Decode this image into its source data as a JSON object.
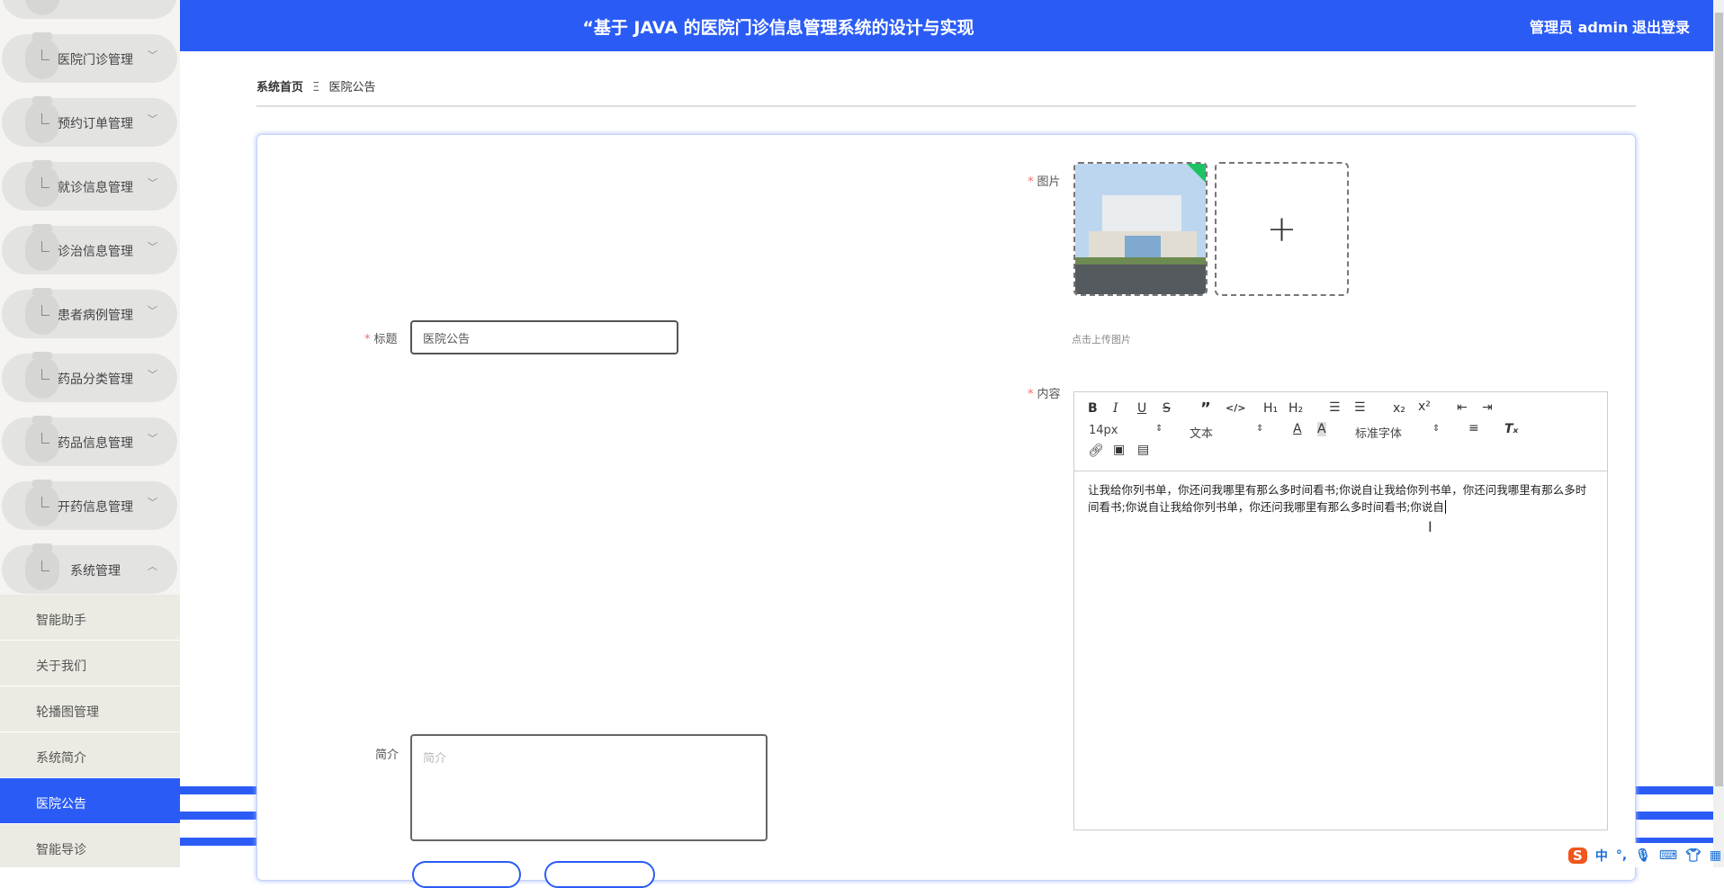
{
  "header": {
    "title": "“基于 JAVA 的医院门诊信息管理系统的设计与实现",
    "user": "管理员 admin",
    "logout": "退出登录"
  },
  "sidebar": {
    "menus": [
      {
        "label": "医院门诊管理"
      },
      {
        "label": "预约订单管理"
      },
      {
        "label": "就诊信息管理"
      },
      {
        "label": "诊治信息管理"
      },
      {
        "label": "患者病例管理"
      },
      {
        "label": "药品分类管理"
      },
      {
        "label": "药品信息管理"
      },
      {
        "label": "开药信息管理"
      },
      {
        "label": "系统管理"
      }
    ],
    "submenu": [
      {
        "label": "智能助手"
      },
      {
        "label": "关于我们"
      },
      {
        "label": "轮播图管理"
      },
      {
        "label": "系统简介"
      },
      {
        "label": "医院公告"
      },
      {
        "label": "智能导诊"
      }
    ]
  },
  "breadcrumb": {
    "home": "系统首页",
    "sep": "Ξ",
    "current": "医院公告"
  },
  "form": {
    "title_label": "标题",
    "title_value": "医院公告",
    "image_label": "图片",
    "upload_hint": "点击上传图片",
    "content_label": "内容",
    "content_value": "让我给你列书单，你还问我哪里有那么多时间看书;你说自让我给你列书单，你还问我哪里有那么多时间看书;你说自让我给你列书单，你还问我哪里有那么多时间看书;你说自",
    "summary_label": "简介",
    "summary_placeholder": "简介"
  },
  "editor": {
    "font_size": "14px",
    "block": "文本",
    "font_family": "标准字体"
  },
  "colors": {
    "primary": "#2a5cf5",
    "required": "#f56c6c"
  }
}
